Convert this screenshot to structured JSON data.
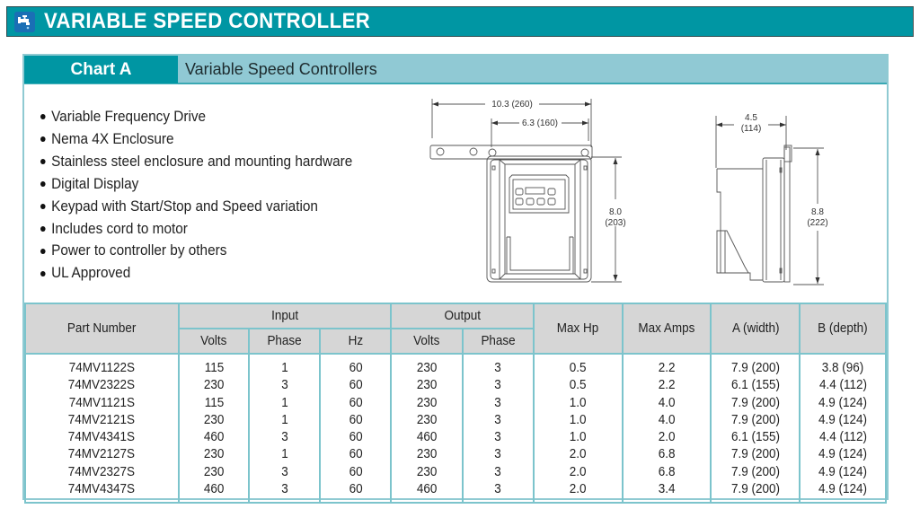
{
  "banner": {
    "icon": "faucet-icon",
    "title": "VARIABLE SPEED CONTROLLER",
    "color": "#0096a3"
  },
  "chart": {
    "label": "Chart A",
    "subtitle": "Variable Speed Controllers",
    "label_color": "#0096a3",
    "subtitle_color": "#90c9d4"
  },
  "features": [
    "Variable Frequency Drive",
    "Nema 4X Enclosure",
    "Stainless steel enclosure and mounting hardware",
    "Digital Display",
    "Keypad with Start/Stop and Speed variation",
    "Includes cord to motor",
    "Power to controller by others",
    "UL Approved"
  ],
  "front_view": {
    "overall_width": "10.3 (260)",
    "body_width": "6.3 (160)",
    "height_in": "8.0",
    "height_mm": "(203)"
  },
  "side_view": {
    "depth_in": "4.5",
    "depth_mm": "(114)",
    "height_in": "8.8",
    "height_mm": "(222)"
  },
  "table": {
    "headers": {
      "part_number": "Part Number",
      "input": "Input",
      "output": "Output",
      "max_hp": "Max Hp",
      "max_amps": "Max Amps",
      "a_width": "A (width)",
      "b_depth": "B (depth)",
      "volts": "Volts",
      "phase": "Phase",
      "hz": "Hz"
    },
    "rows": [
      [
        "74MV1122S",
        "115",
        "1",
        "60",
        "230",
        "3",
        "0.5",
        "2.2",
        "7.9 (200)",
        "3.8 (96)"
      ],
      [
        "74MV2322S",
        "230",
        "3",
        "60",
        "230",
        "3",
        "0.5",
        "2.2",
        "6.1 (155)",
        "4.4 (112)"
      ],
      [
        "74MV1121S",
        "115",
        "1",
        "60",
        "230",
        "3",
        "1.0",
        "4.0",
        "7.9 (200)",
        "4.9 (124)"
      ],
      [
        "74MV2121S",
        "230",
        "1",
        "60",
        "230",
        "3",
        "1.0",
        "4.0",
        "7.9 (200)",
        "4.9 (124)"
      ],
      [
        "74MV4341S",
        "460",
        "3",
        "60",
        "460",
        "3",
        "1.0",
        "2.0",
        "6.1 (155)",
        "4.4 (112)"
      ],
      [
        "74MV2127S",
        "230",
        "1",
        "60",
        "230",
        "3",
        "2.0",
        "6.8",
        "7.9 (200)",
        "4.9 (124)"
      ],
      [
        "74MV2327S",
        "230",
        "3",
        "60",
        "230",
        "3",
        "2.0",
        "6.8",
        "7.9 (200)",
        "4.9 (124)"
      ],
      [
        "74MV4347S",
        "460",
        "3",
        "60",
        "460",
        "3",
        "2.0",
        "3.4",
        "7.9 (200)",
        "4.9 (124)"
      ]
    ],
    "border_color": "#7cc4cc",
    "header_bg": "#d6d6d6"
  }
}
